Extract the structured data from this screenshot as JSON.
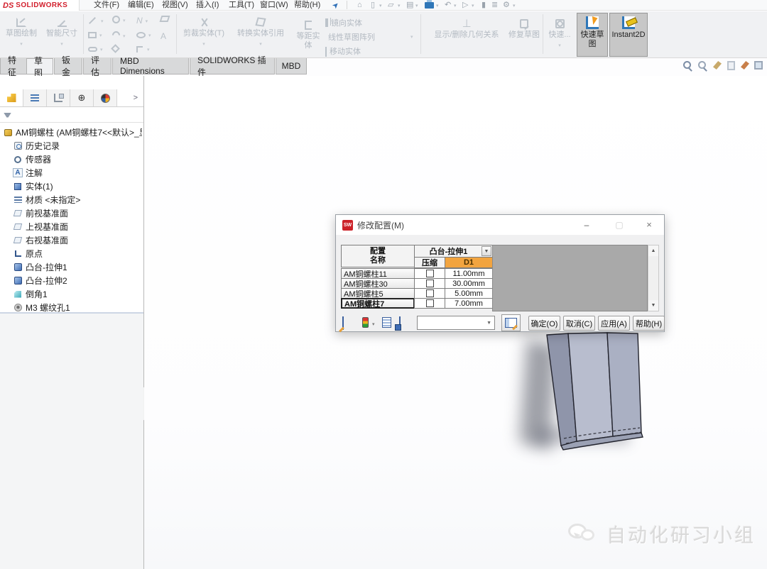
{
  "app": {
    "logo_prefix": "DS",
    "logo_brand": "SOLIDWORKS"
  },
  "menu": {
    "items": [
      "文件(F)",
      "编辑(E)",
      "视图(V)",
      "插入(I)",
      "工具(T)",
      "窗口(W)",
      "帮助(H)"
    ]
  },
  "quick_access": {
    "icons": [
      "pin",
      "home",
      "new-document",
      "open",
      "save",
      "print",
      "undo",
      "select-pointer",
      "eyedropper",
      "task-list",
      "options-gear"
    ]
  },
  "ribbon": {
    "sketch": "草图绘制",
    "smart_dimension": "智能尺寸",
    "trim": "剪裁实体(T)",
    "convert": "转换实体引用",
    "offset": "等距实体",
    "mirror": "镜向实体",
    "linear_pattern": "线性草图阵列",
    "move": "移动实体",
    "display_relations": "显示/删除几何关系",
    "repair": "修复草图",
    "quick_snaps": "快速...",
    "rapid_sketch": "快速草图",
    "instant2d": "Instant2D"
  },
  "tabs": {
    "items": [
      "特征",
      "草图",
      "钣金",
      "评估",
      "MBD Dimensions",
      "SOLIDWORKS 插件",
      "MBD"
    ],
    "active": "草图"
  },
  "view_toolbar": {
    "icons": [
      "zoom-to-fit",
      "zoom-to-area",
      "section-view",
      "view-orientation",
      "edit-appearance",
      "apply-scene"
    ]
  },
  "feature_tree": {
    "root": "AM铜螺柱 (AM铜螺柱7<<默认>_显",
    "items": [
      "历史记录",
      "传感器",
      "注解",
      "实体(1)",
      "材质 <未指定>",
      "前视基准面",
      "上视基准面",
      "右视基准面",
      "原点",
      "凸台-拉伸1",
      "凸台-拉伸2",
      "倒角1",
      "M3 螺纹孔1"
    ],
    "expand_arrow": ">"
  },
  "dialog": {
    "title": "修改配置(M)",
    "window_controls": {
      "minimize": "–",
      "maximize": "▢",
      "close": "×"
    },
    "table": {
      "config_header_line1": "配置",
      "config_header_line2": "名称",
      "feature_header": "凸台-拉伸1",
      "suppress_header": "压缩",
      "dim_header": "D1",
      "rows": [
        {
          "name": "AM铜螺柱11",
          "suppressed": false,
          "value": "11.00mm",
          "active": false
        },
        {
          "name": "AM铜螺柱30",
          "suppressed": false,
          "value": "30.00mm",
          "active": false
        },
        {
          "name": "AM铜螺柱5",
          "suppressed": false,
          "value": "5.00mm",
          "active": false
        },
        {
          "name": "AM铜螺柱7",
          "suppressed": false,
          "value": "7.00mm",
          "active": true
        }
      ]
    },
    "combo_value": "",
    "buttons": {
      "ok": "确定(O)",
      "cancel": "取消(C)",
      "apply": "应用(A)",
      "help": "帮助(H)"
    }
  },
  "watermark": {
    "text": "自动化研习小组"
  },
  "glyphs": {
    "pin": "➤",
    "home": "⌂",
    "doc": "▯",
    "folder": "▱",
    "save": "▤",
    "undo": "↶",
    "pointer": "▷",
    "dropper": "▮",
    "list": "≣",
    "gear": "⚙",
    "arrow_down": "▼",
    "small_arrow": "▾",
    "perp": "⊥",
    "target": "⊕",
    "spline": "N",
    "text_tool": "A",
    "scroll_up": "▲",
    "scroll_down": "▼",
    "combo_arrow": "▼"
  },
  "colors": {
    "logo_red": "#d21f2c",
    "d1_header_orange": "#f2a43f",
    "table_filler_gray": "#a9a9a9",
    "model_face_light": "#b8bdce",
    "model_face_dark": "#8f95aa",
    "active_button_gray": "#c7c7c7"
  }
}
